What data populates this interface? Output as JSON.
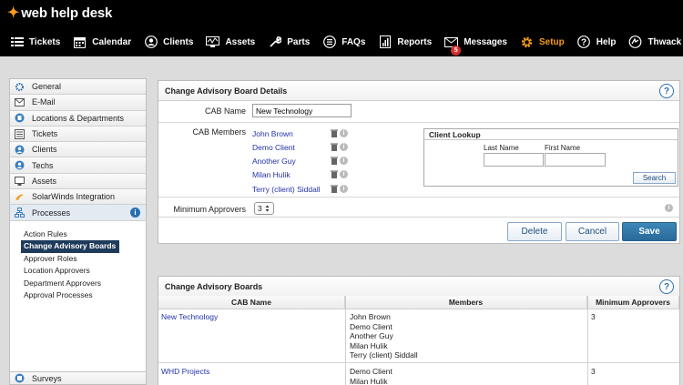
{
  "app": {
    "logo_text": "web help desk"
  },
  "nav": [
    {
      "label": "Tickets",
      "icon": "tickets-icon"
    },
    {
      "label": "Calendar",
      "icon": "calendar-icon"
    },
    {
      "label": "Clients",
      "icon": "clients-icon"
    },
    {
      "label": "Assets",
      "icon": "assets-icon"
    },
    {
      "label": "Parts",
      "icon": "wrench-icon"
    },
    {
      "label": "FAQs",
      "icon": "list-icon"
    },
    {
      "label": "Reports",
      "icon": "reports-icon"
    },
    {
      "label": "Messages",
      "icon": "envelope-icon",
      "badge": "5"
    },
    {
      "label": "Setup",
      "icon": "gear-icon",
      "active": true
    },
    {
      "label": "Help",
      "icon": "help-icon"
    },
    {
      "label": "Thwack",
      "icon": "thwack-icon"
    }
  ],
  "colors": {
    "accent": "#f59a1e",
    "topbar": "#000000",
    "primary_button": "#2f78a8",
    "link": "#2233aa",
    "badge": "#d32f2f",
    "selected_nav": "#1f3b5c"
  },
  "sidebar": {
    "items": [
      {
        "label": "General",
        "icon": "gear-icon"
      },
      {
        "label": "E-Mail",
        "icon": "envelope-icon"
      },
      {
        "label": "Locations & Departments",
        "icon": "building-icon"
      },
      {
        "label": "Tickets",
        "icon": "tickets-icon"
      },
      {
        "label": "Clients",
        "icon": "clients-icon"
      },
      {
        "label": "Techs",
        "icon": "techs-icon"
      },
      {
        "label": "Assets",
        "icon": "assets-icon"
      },
      {
        "label": "SolarWinds Integration",
        "icon": "solarwinds-icon"
      },
      {
        "label": "Processes",
        "icon": "processes-icon"
      }
    ],
    "processes_info": "i",
    "sub_items": [
      {
        "label": "Action Rules"
      },
      {
        "label": "Change Advisory Boards",
        "selected": true
      },
      {
        "label": "Approver Roles"
      },
      {
        "label": "Location Approvers"
      },
      {
        "label": "Department Approvers"
      },
      {
        "label": "Approval Processes"
      }
    ],
    "bottom_item": {
      "label": "Surveys",
      "icon": "surveys-icon"
    }
  },
  "details": {
    "title": "Change Advisory Board Details",
    "help": "?",
    "cab_name_label": "CAB Name",
    "cab_name_value": "New Technology",
    "members_label": "CAB Members",
    "members": [
      "John Brown",
      "Demo Client",
      "Another Guy",
      "Milan Hulik",
      "Terry (client) Siddall"
    ],
    "client_lookup": {
      "title": "Client Lookup",
      "last_name_label": "Last Name",
      "first_name_label": "First Name",
      "search_label": "Search"
    },
    "min_approvers_label": "Minimum Approvers",
    "min_approvers_value": "3",
    "buttons": {
      "delete": "Delete",
      "cancel": "Cancel",
      "save": "Save"
    }
  },
  "boards": {
    "title": "Change Advisory Boards",
    "help": "?",
    "columns": [
      "CAB Name",
      "Members",
      "Minimum Approvers"
    ],
    "rows": [
      {
        "name": "New Technology",
        "members": [
          "John Brown",
          "Demo Client",
          "Another Guy",
          "Milan Hulik",
          "Terry (client) Siddall"
        ],
        "min": "3"
      },
      {
        "name": "WHD Projects",
        "members": [
          "Demo Client",
          "Milan Hulik"
        ],
        "min": "3"
      }
    ]
  }
}
